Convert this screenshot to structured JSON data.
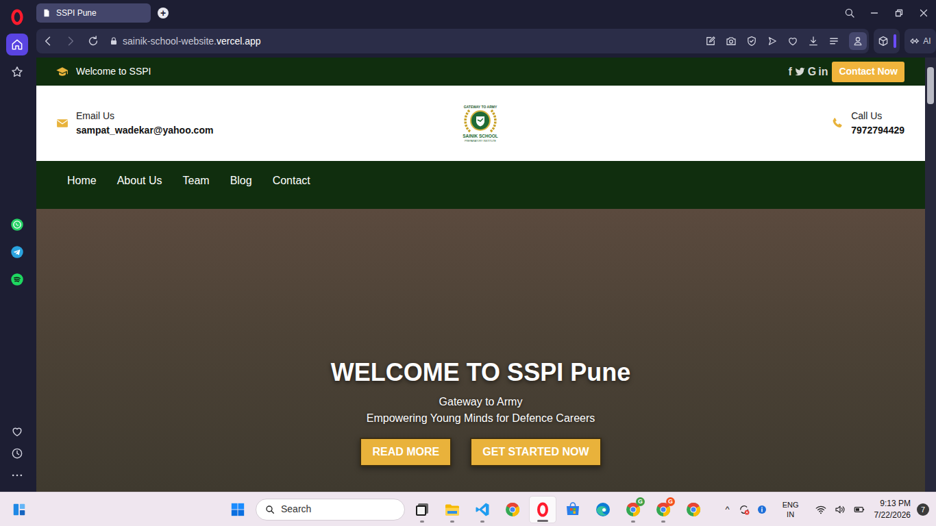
{
  "browser": {
    "tabs": [
      {
        "label": "SSPI Pune",
        "selected": true
      }
    ],
    "new_tab_button": "+",
    "address": {
      "prefix": "sainik-school-website.",
      "domain": "vercel.app"
    },
    "ai_button": "AI",
    "sidebar": [
      {
        "kind": "home",
        "selected": true
      },
      {
        "kind": "bookmarks",
        "selected": false
      },
      {
        "kind": "whatsapp",
        "selected": false
      },
      {
        "kind": "telegram",
        "selected": false
      },
      {
        "kind": "spotify",
        "selected": false
      },
      {
        "kind": "favorites",
        "selected": false
      },
      {
        "kind": "history",
        "selected": false
      },
      {
        "kind": "more",
        "selected": false
      }
    ]
  },
  "page": {
    "topbar": {
      "welcome": "Welcome to SSPI",
      "social": [
        {
          "kind": "facebook",
          "glyph": "f"
        },
        {
          "kind": "twitter"
        },
        {
          "kind": "google",
          "glyph": "G"
        },
        {
          "kind": "linkedin",
          "glyph": "in"
        }
      ],
      "contact_button": "Contact Now"
    },
    "header": {
      "email_label": "Email Us",
      "email": "sampat_wadekar@yahoo.com",
      "logo": {
        "top": "GATEWAY TO ARMY",
        "name": "SAINIK SCHOOL",
        "sub": "PREPARATORY INSTITUTE"
      },
      "call_label": "Call Us",
      "phone": "7972794429"
    },
    "nav": [
      "Home",
      "About Us",
      "Team",
      "Blog",
      "Contact"
    ],
    "hero": {
      "title": "WELCOME TO SSPI Pune",
      "subtitle": "Gateway to Army",
      "tagline": "Empowering Young Minds for Defence Careers",
      "buttons": [
        "READ MORE",
        "GET STARTED NOW"
      ]
    }
  },
  "taskbar": {
    "search": {
      "placeholder": "Search"
    },
    "apps": [
      {
        "kind": "terminal",
        "running": true,
        "selected": false
      },
      {
        "kind": "explorer",
        "running": true,
        "selected": false
      },
      {
        "kind": "vscode",
        "running": true,
        "selected": false
      },
      {
        "kind": "chrome",
        "running": false,
        "selected": false
      },
      {
        "kind": "opera",
        "running": true,
        "selected": true
      },
      {
        "kind": "store",
        "running": false,
        "selected": false
      },
      {
        "kind": "edge",
        "running": false,
        "selected": false
      },
      {
        "kind": "chrome",
        "running": true,
        "selected": false,
        "badge": {
          "text": "G",
          "color": "#43a047"
        }
      },
      {
        "kind": "chrome",
        "running": true,
        "selected": false,
        "badge": {
          "text": "G",
          "color": "#f4511e"
        }
      },
      {
        "kind": "chrome",
        "running": false,
        "selected": false
      }
    ],
    "tray": {
      "overflow": "^",
      "language": "ENG",
      "region": "IN",
      "time": "9:13 PM",
      "date": "7/22/2026",
      "notifications": "7"
    }
  }
}
